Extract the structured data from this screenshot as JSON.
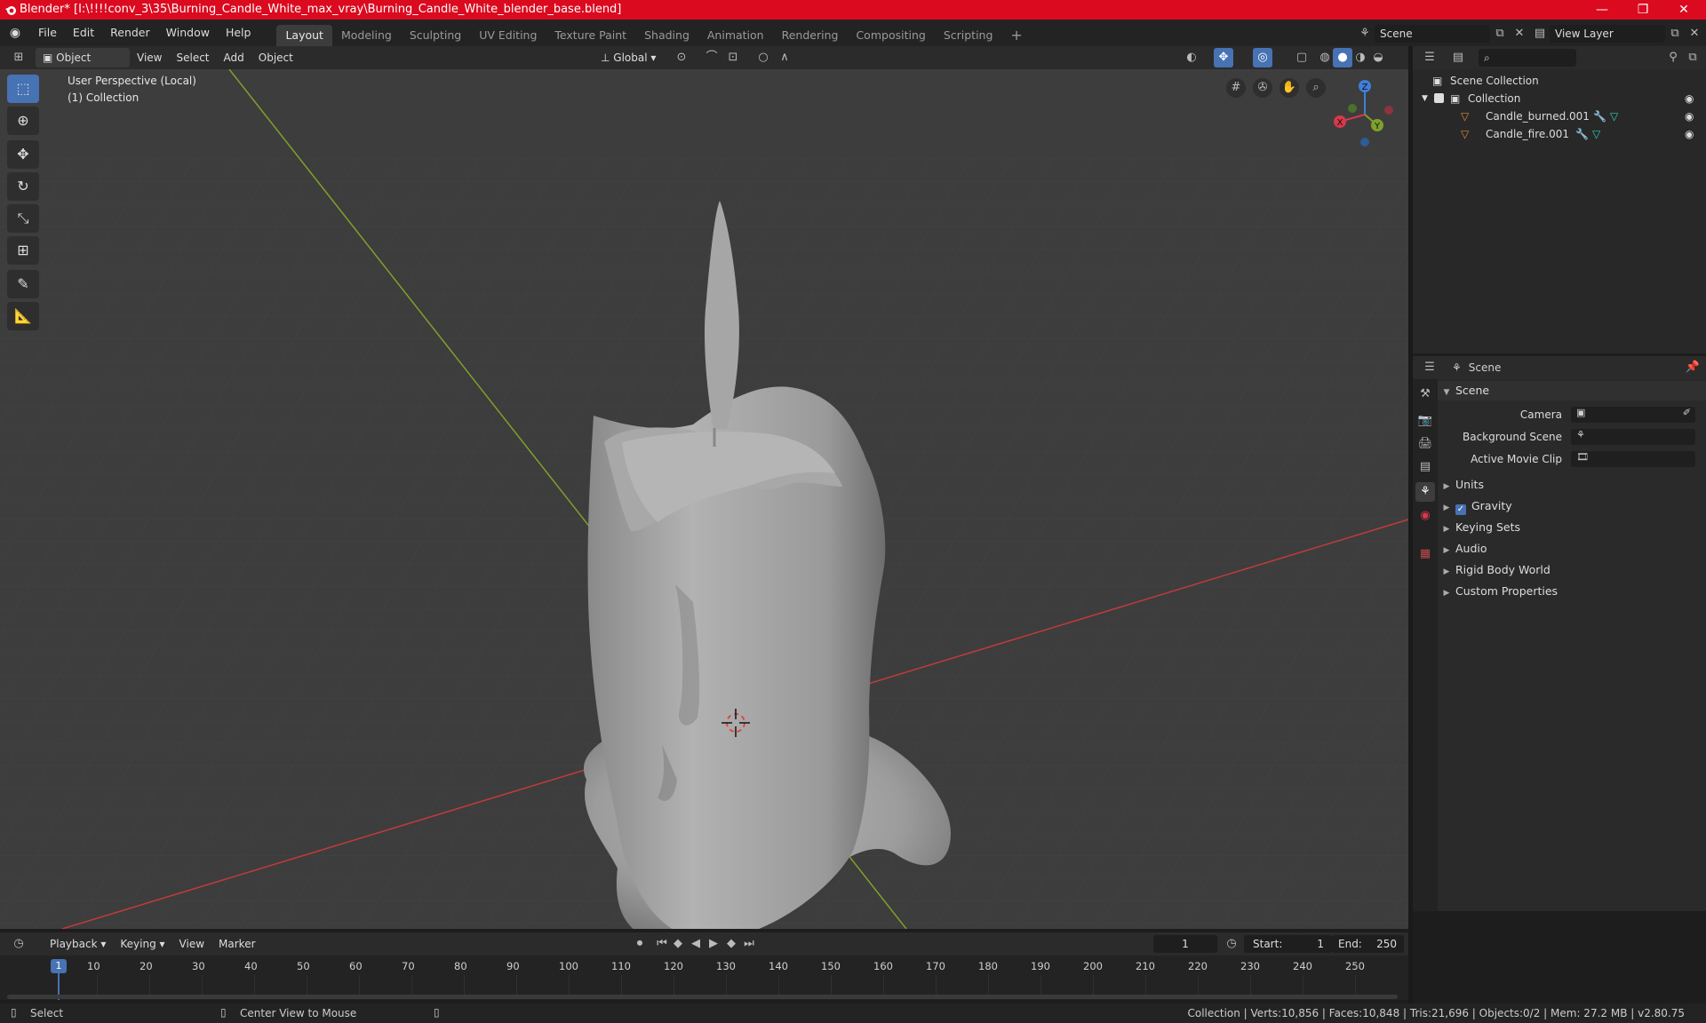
{
  "titlebar": {
    "title": "Blender* [I:\\!!!!conv_3\\35\\Burning_Candle_White_max_vray\\Burning_Candle_White_blender_base.blend]",
    "minimize": "—",
    "maximize": "❐",
    "close": "✕"
  },
  "menu": [
    "File",
    "Edit",
    "Render",
    "Window",
    "Help"
  ],
  "workspaces": [
    "Layout",
    "Modeling",
    "Sculpting",
    "UV Editing",
    "Texture Paint",
    "Shading",
    "Animation",
    "Rendering",
    "Compositing",
    "Scripting"
  ],
  "workspace_add": "+",
  "scene_field": "Scene",
  "view_layer_field": "View Layer",
  "viewport_header": {
    "mode": "Object Mode",
    "view": "View",
    "select": "Select",
    "add": "Add",
    "object": "Object",
    "orientation": "Global"
  },
  "viewport": {
    "overlay_line1": "User Perspective (Local)",
    "overlay_line2": "(1) Collection",
    "gizmo_x": "X",
    "gizmo_y": "Y",
    "gizmo_z": "Z"
  },
  "outliner": {
    "search_placeholder": "",
    "root": "Scene Collection",
    "collection": "Collection",
    "items": [
      "Candle_burned.001",
      "Candle_fire.001"
    ]
  },
  "properties": {
    "header_title": "Scene",
    "section_scene": "Scene",
    "camera_label": "Camera",
    "background_scene_label": "Background Scene",
    "active_movie_clip_label": "Active Movie Clip",
    "sections": [
      "Units",
      "Gravity",
      "Keying Sets",
      "Audio",
      "Rigid Body World",
      "Custom Properties"
    ],
    "gravity_checked": true
  },
  "timeline": {
    "playback": "Playback",
    "keying": "Keying",
    "view": "View",
    "marker": "Marker",
    "current_frame": "1",
    "start_label": "Start:",
    "start_value": "1",
    "end_label": "End:",
    "end_value": "250",
    "ticks": [
      "1",
      "10",
      "20",
      "30",
      "40",
      "50",
      "60",
      "70",
      "80",
      "90",
      "100",
      "110",
      "120",
      "130",
      "140",
      "150",
      "160",
      "170",
      "180",
      "190",
      "200",
      "210",
      "220",
      "230",
      "240",
      "250"
    ]
  },
  "statusbar": {
    "select": "Select",
    "center_view": "Center View to Mouse",
    "stats": "Collection | Verts:10,856 | Faces:10,848 | Tris:21,696 | Objects:0/2 | Mem: 27.2 MB | v2.80.75"
  },
  "colors": {
    "accent": "#4772b3",
    "titlebar": "#db0a1f",
    "viewport_bg": "#3d3d3d",
    "x_axis": "#c23b3b",
    "y_axis": "#7ea12a"
  }
}
